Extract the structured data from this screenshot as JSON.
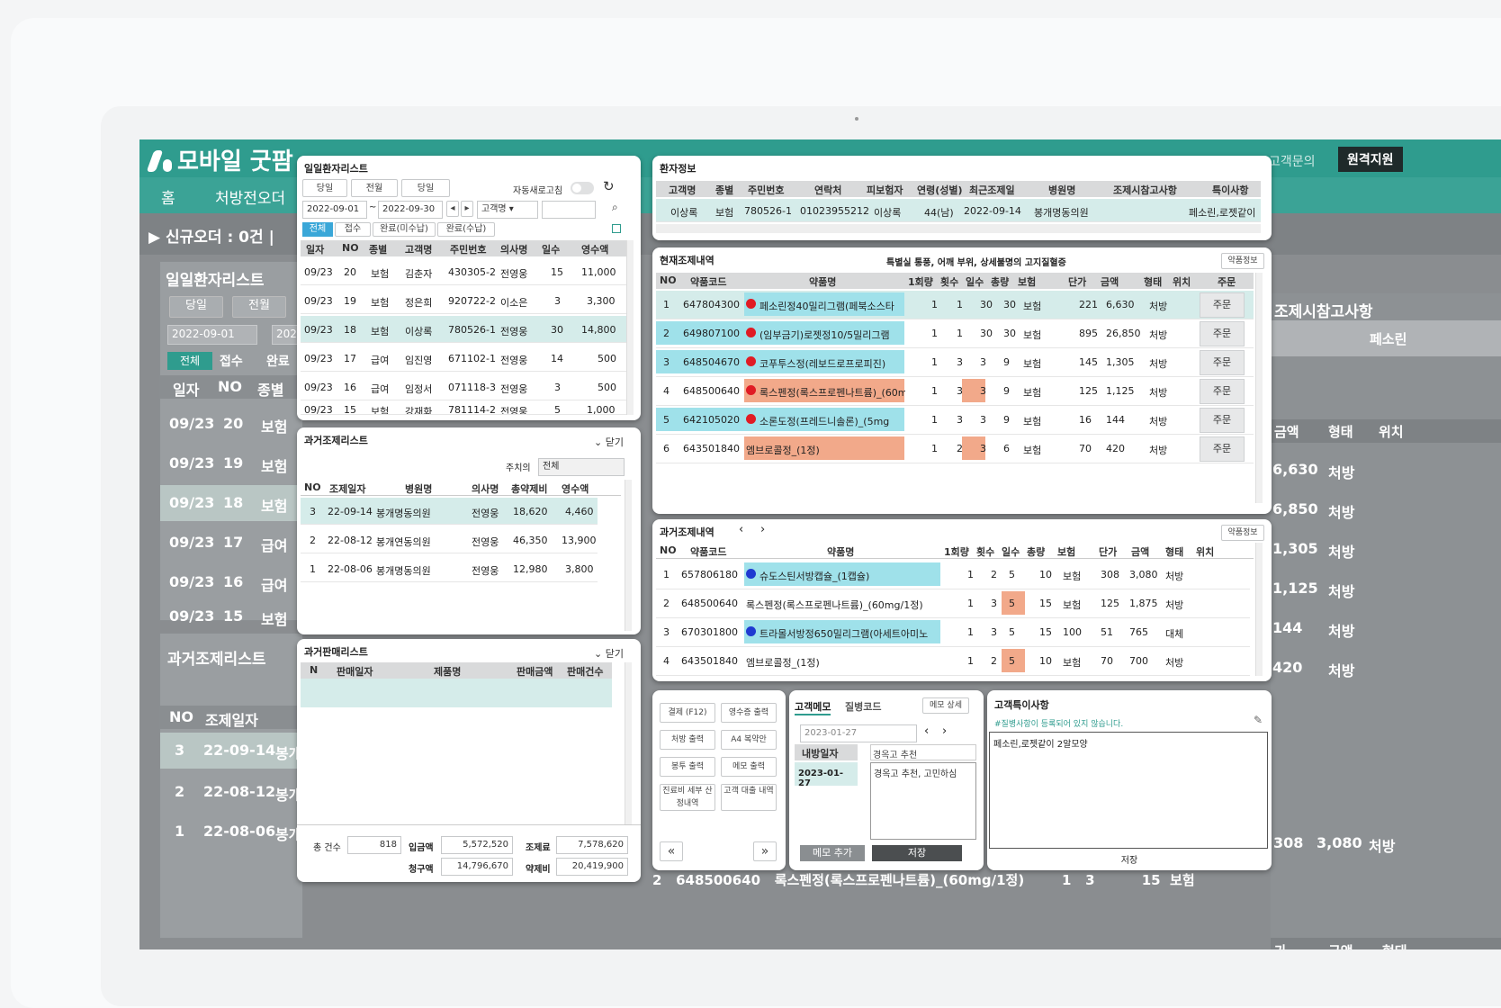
{
  "app": {
    "title": "모바일 굿팜",
    "remote_btn": "원격지원",
    "top_right_text": "고객문의"
  },
  "nav": {
    "items": [
      "홈",
      "처방전오더"
    ]
  },
  "orderbar": {
    "text": "▶ 신규오더 : 0건  |"
  },
  "bg": {
    "daily_title": "일일환자리스트",
    "tabs": [
      "당일",
      "전월"
    ],
    "date_from": "2022-09-01",
    "date_to": "202",
    "filters": [
      "전체",
      "접수",
      "완료"
    ],
    "head": [
      "일자",
      "NO",
      "종별"
    ],
    "rows": [
      [
        "09/23",
        "20",
        "보험"
      ],
      [
        "09/23",
        "19",
        "보험"
      ],
      [
        "09/23",
        "18",
        "보험"
      ],
      [
        "09/23",
        "17",
        "급여"
      ],
      [
        "09/23",
        "16",
        "급여"
      ],
      [
        "09/23",
        "15",
        "보험"
      ]
    ],
    "past_title": "과거조제리스트",
    "past_head": [
      "NO",
      "조제일자"
    ],
    "past_rows": [
      [
        "3",
        "22-09-14",
        "봉개"
      ],
      [
        "2",
        "22-08-12",
        "봉개"
      ],
      [
        "1",
        "22-08-06",
        "봉개"
      ]
    ],
    "right_header": "조제시참고사항",
    "right_val": "페소린",
    "right_head": [
      "금액",
      "형태",
      "위치"
    ],
    "right_rows": [
      [
        "6,630",
        "처방"
      ],
      [
        "6,850",
        "처방"
      ],
      [
        "1,305",
        "처방"
      ],
      [
        "1,125",
        "처방"
      ],
      [
        "144",
        "처방"
      ],
      [
        "420",
        "처방"
      ]
    ],
    "right_bottom_head": [
      "가",
      "금액",
      "형태"
    ],
    "right_bottom_row": [
      "308",
      "3,080",
      "처방"
    ],
    "bottom_cut": "2   648500640   록스펜정(록스프로펜나트륨)_(60mg/1정)        1   3          15  보험"
  },
  "daily": {
    "title": "일일환자리스트",
    "tabs": [
      "당일",
      "전월",
      "당일"
    ],
    "auto_label": "자동새로고침",
    "date_from": "2022-09-01",
    "date_to": "2022-09-30",
    "search_type": "고객명",
    "filters": [
      "전체",
      "접수",
      "완료(미수납)",
      "완료(수납)"
    ],
    "head": [
      "일자",
      "NO",
      "종별",
      "고객명",
      "주민번호",
      "의사명",
      "일수",
      "영수액"
    ],
    "rows": [
      [
        "09/23",
        "20",
        "보험",
        "김춘자",
        "430305-2",
        "전영웅",
        "15",
        "11,000"
      ],
      [
        "09/23",
        "19",
        "보험",
        "정은희",
        "920722-2",
        "이소은",
        "3",
        "3,300"
      ],
      [
        "09/23",
        "18",
        "보험",
        "이상록",
        "780526-1",
        "전영웅",
        "30",
        "14,800"
      ],
      [
        "09/23",
        "17",
        "급여",
        "임진영",
        "671102-1",
        "전영웅",
        "14",
        "500"
      ],
      [
        "09/23",
        "16",
        "급여",
        "임정서",
        "071118-3",
        "전영웅",
        "3",
        "500"
      ],
      [
        "09/23",
        "15",
        "보험",
        "강재화",
        "781114-2",
        "전영웅",
        "5",
        "1,000"
      ]
    ]
  },
  "pastlist": {
    "title": "과거조제리스트",
    "close": "닫기",
    "doctor_label": "주치의",
    "doctor_val": "전체",
    "head": [
      "NO",
      "조제일자",
      "병원명",
      "의사명",
      "총약제비",
      "영수액"
    ],
    "rows": [
      [
        "3",
        "22-09-14",
        "봉개명동의원",
        "전영웅",
        "18,620",
        "4,460"
      ],
      [
        "2",
        "22-08-12",
        "봉개연동의원",
        "전영웅",
        "46,350",
        "13,900"
      ],
      [
        "1",
        "22-08-06",
        "봉개명동의원",
        "전영웅",
        "12,980",
        "3,800"
      ]
    ]
  },
  "salelist": {
    "title": "과거판매리스트",
    "close": "닫기",
    "head": [
      "N",
      "판매일자",
      "제품명",
      "판매금액",
      "판매건수"
    ],
    "sum": {
      "count_label": "총 건수",
      "count": "818",
      "paid_label": "입금액",
      "paid": "5,572,520",
      "drug_label": "조제료",
      "drug": "7,578,620",
      "claim_label": "청구액",
      "claim": "14,796,670",
      "med_label": "약제비",
      "med": "20,419,900"
    }
  },
  "patient": {
    "title": "환자정보",
    "head": [
      "고객명",
      "종별",
      "주민번호",
      "연락처",
      "피보험자",
      "연령(성별)",
      "최근조제일",
      "병원명",
      "조제시참고사항",
      "특이사항"
    ],
    "row": [
      "이상록",
      "보험",
      "780526-1",
      "01023955212",
      "이상록",
      "44(남)",
      "2022-09-14",
      "봉개명동의원",
      "",
      "페소린,로젯같이"
    ]
  },
  "current": {
    "title": "현재조제내역",
    "note": "특별실 통풍, 어깨 부위, 상세불명의 고지질혈증",
    "info_btn": "약품정보",
    "head": [
      "NO",
      "약품코드",
      "약품명",
      "1회량",
      "횟수",
      "일수",
      "총량",
      "보험",
      "단가",
      "금액",
      "형태",
      "위치",
      "주문"
    ],
    "rows": [
      [
        "1",
        "647804300",
        "페소린정40밀리그램(페북소스타",
        "1",
        "1",
        "30",
        "30",
        "보험",
        "221",
        "6,630",
        "처방",
        "",
        "주문"
      ],
      [
        "2",
        "649807100",
        "(임부금기)로젯정10/5밀리그램",
        "1",
        "1",
        "30",
        "30",
        "보험",
        "895",
        "26,850",
        "처방",
        "",
        "주문"
      ],
      [
        "3",
        "648504670",
        "코푸투스정(레보드로프로피진)",
        "1",
        "3",
        "3",
        "9",
        "보험",
        "145",
        "1,305",
        "처방",
        "",
        "주문"
      ],
      [
        "4",
        "648500640",
        "록스펜정(록스프로펜나트륨)_(60m",
        "1",
        "3",
        "3",
        "9",
        "보험",
        "125",
        "1,125",
        "처방",
        "",
        "주문"
      ],
      [
        "5",
        "642105020",
        "소론도정(프레드니솔론)_(5mg",
        "1",
        "3",
        "3",
        "9",
        "보험",
        "16",
        "144",
        "처방",
        "",
        "주문"
      ],
      [
        "6",
        "643501840",
        "엠브로콜정_(1정)",
        "1",
        "2",
        "3",
        "6",
        "보험",
        "70",
        "420",
        "처방",
        "",
        "주문"
      ]
    ]
  },
  "past": {
    "title": "과거조제내역",
    "info_btn": "약품정보",
    "head": [
      "NO",
      "약품코드",
      "약품명",
      "1회량",
      "횟수",
      "일수",
      "총량",
      "보험",
      "단가",
      "금액",
      "형태",
      "위치"
    ],
    "rows": [
      [
        "1",
        "657806180",
        "슈도스틴서방캡슐_(1캡슐)",
        "1",
        "2",
        "5",
        "10",
        "보험",
        "308",
        "3,080",
        "처방",
        ""
      ],
      [
        "2",
        "648500640",
        "록스펜정(록스프로펜나트륨)_(60mg/1정)",
        "1",
        "3",
        "5",
        "15",
        "보험",
        "125",
        "1,875",
        "처방",
        ""
      ],
      [
        "3",
        "670301800",
        "트라몰서방정650밀리그램(아세트아미노",
        "1",
        "3",
        "5",
        "15",
        "100",
        "51",
        "765",
        "대체",
        ""
      ],
      [
        "4",
        "643501840",
        "엠브로콜정_(1정)",
        "1",
        "2",
        "5",
        "10",
        "보험",
        "70",
        "700",
        "처방",
        ""
      ]
    ]
  },
  "actions": {
    "buttons": [
      "결제 (F12)",
      "영수증 출력",
      "처방 출력",
      "A4 복약안",
      "봉투 출력",
      "메모 출력",
      "진료비 세부 산정내역",
      "고객 대출 내역"
    ]
  },
  "memo": {
    "tabs": [
      "고객메모",
      "질병코드"
    ],
    "detail_btn": "메모 상세",
    "date": "2023-01-27",
    "head": [
      "내방일자",
      "경옥고 추천"
    ],
    "row_date": "2023-01-27",
    "content": "경옥고 추천, 고민하심",
    "add_btn": "메모 추가",
    "save_btn": "저장"
  },
  "special": {
    "title": "고객특이사항",
    "hint": "#질병사항이 등록되어 있지 않습니다.",
    "content": "페소린,로젯같이 2알모양",
    "save_btn": "저장"
  }
}
